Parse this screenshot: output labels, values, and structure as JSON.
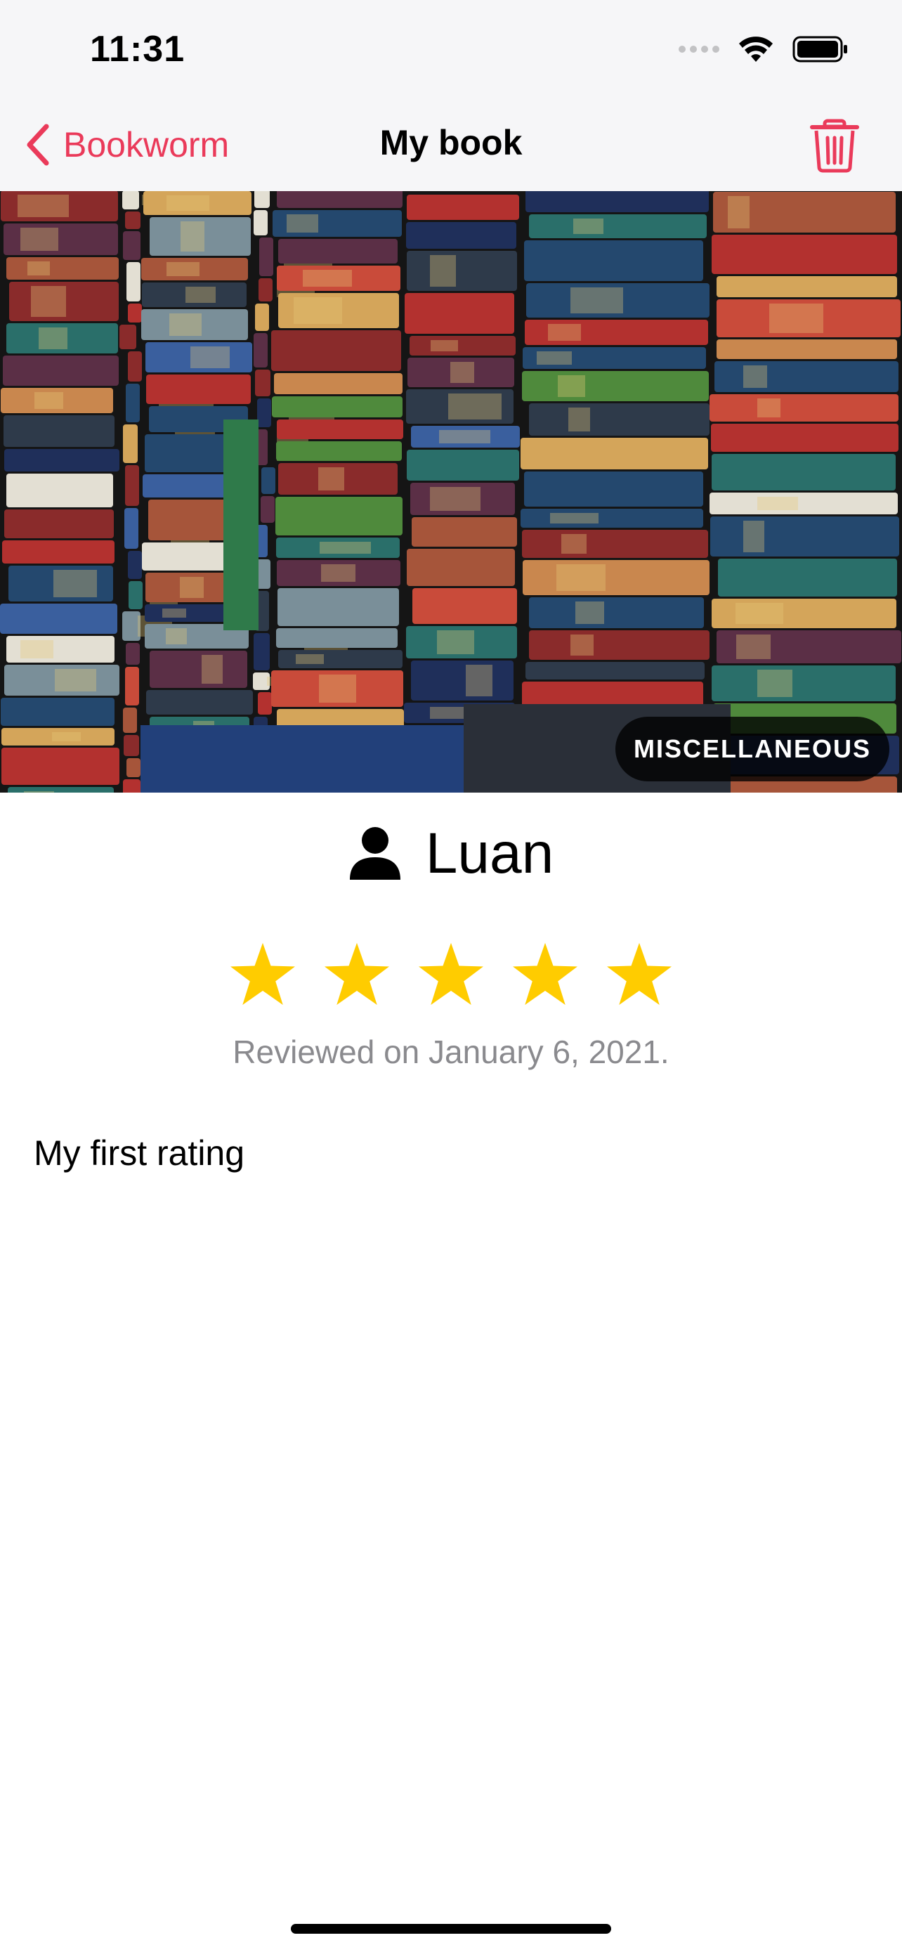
{
  "status_bar": {
    "time": "11:31"
  },
  "nav": {
    "back_label": "Bookworm",
    "title": "My book",
    "back_icon": "chevron-left-icon",
    "trash_icon": "trash-icon"
  },
  "book": {
    "genre": "MISCELLANEOUS",
    "cover_image": "stacks-of-old-books-photo"
  },
  "review": {
    "reviewer_icon": "person-icon",
    "reviewer": "Luan",
    "rating": 5,
    "rating_max": 5,
    "date_text": "Reviewed on January 6, 2021.",
    "text": "My first rating"
  },
  "colors": {
    "accent": "#ea3a5a",
    "star": "#ffcc00",
    "secondary_text": "#8a8a8e",
    "bar_background": "#f6f6f8"
  }
}
